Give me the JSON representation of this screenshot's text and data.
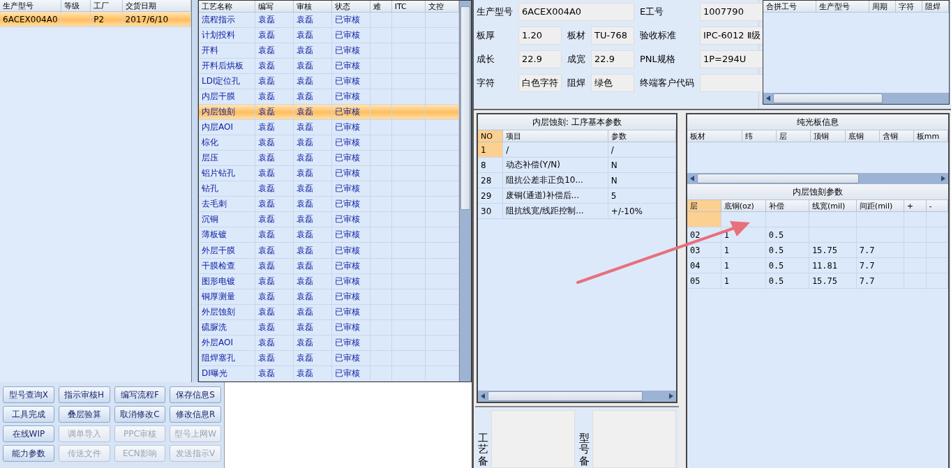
{
  "left_grid": {
    "columns": [
      "生产型号",
      "等级",
      "工厂",
      "交货日期"
    ],
    "rows": [
      {
        "cells": [
          "6ACEX004A0",
          null,
          "P2",
          "2017/6/10"
        ],
        "selected": true
      }
    ]
  },
  "process_table": {
    "columns": [
      "工艺名称",
      "编写",
      "审核",
      "状态",
      "难",
      "ITC",
      "文控"
    ],
    "rows": [
      {
        "cells": [
          "流程指示",
          "袁磊",
          "袁磊",
          "已审核"
        ],
        "selected": false
      },
      {
        "cells": [
          "计划投料",
          "袁磊",
          "袁磊",
          "已审核"
        ],
        "selected": false
      },
      {
        "cells": [
          "开料",
          "袁磊",
          "袁磊",
          "已审核"
        ],
        "selected": false
      },
      {
        "cells": [
          "开料后烘板",
          "袁磊",
          "袁磊",
          "已审核"
        ],
        "selected": false
      },
      {
        "cells": [
          "LDI定位孔",
          "袁磊",
          "袁磊",
          "已审核"
        ],
        "selected": false
      },
      {
        "cells": [
          "内层干膜",
          "袁磊",
          "袁磊",
          "已审核"
        ],
        "selected": false
      },
      {
        "cells": [
          "内层蚀刻",
          "袁磊",
          "袁磊",
          "已审核"
        ],
        "selected": true
      },
      {
        "cells": [
          "内层AOI",
          "袁磊",
          "袁磊",
          "已审核"
        ],
        "selected": false
      },
      {
        "cells": [
          "棕化",
          "袁磊",
          "袁磊",
          "已审核"
        ],
        "selected": false
      },
      {
        "cells": [
          "层压",
          "袁磊",
          "袁磊",
          "已审核"
        ],
        "selected": false
      },
      {
        "cells": [
          "铝片钻孔",
          "袁磊",
          "袁磊",
          "已审核"
        ],
        "selected": false
      },
      {
        "cells": [
          "钻孔",
          "袁磊",
          "袁磊",
          "已审核"
        ],
        "selected": false
      },
      {
        "cells": [
          "去毛刺",
          "袁磊",
          "袁磊",
          "已审核"
        ],
        "selected": false
      },
      {
        "cells": [
          "沉铜",
          "袁磊",
          "袁磊",
          "已审核"
        ],
        "selected": false
      },
      {
        "cells": [
          "薄板镀",
          "袁磊",
          "袁磊",
          "已审核"
        ],
        "selected": false
      },
      {
        "cells": [
          "外层干膜",
          "袁磊",
          "袁磊",
          "已审核"
        ],
        "selected": false
      },
      {
        "cells": [
          "干膜检查",
          "袁磊",
          "袁磊",
          "已审核"
        ],
        "selected": false
      },
      {
        "cells": [
          "图形电镀",
          "袁磊",
          "袁磊",
          "已审核"
        ],
        "selected": false
      },
      {
        "cells": [
          "铜厚测量",
          "袁磊",
          "袁磊",
          "已审核"
        ],
        "selected": false
      },
      {
        "cells": [
          "外层蚀刻",
          "袁磊",
          "袁磊",
          "已审核"
        ],
        "selected": false
      },
      {
        "cells": [
          "硫脲洗",
          "袁磊",
          "袁磊",
          "已审核"
        ],
        "selected": false
      },
      {
        "cells": [
          "外层AOI",
          "袁磊",
          "袁磊",
          "已审核"
        ],
        "selected": false
      },
      {
        "cells": [
          "阻焊塞孔",
          "袁磊",
          "袁磊",
          "已审核"
        ],
        "selected": false
      },
      {
        "cells": [
          "DI曝光",
          "袁磊",
          "袁磊",
          "已审核"
        ],
        "selected": false
      }
    ]
  },
  "buttons": [
    {
      "label": "型号查询X",
      "disabled": false
    },
    {
      "label": "指示审核H",
      "disabled": false
    },
    {
      "label": "编写流程F",
      "disabled": false
    },
    {
      "label": "保存信息S",
      "disabled": false
    },
    {
      "label": "工具完成",
      "disabled": false
    },
    {
      "label": "叠层验算",
      "disabled": false
    },
    {
      "label": "取消修改C",
      "disabled": false
    },
    {
      "label": "修改信息R",
      "disabled": false
    },
    {
      "label": "在线WIP",
      "disabled": false
    },
    {
      "label": "调单导入",
      "disabled": true
    },
    {
      "label": "PPC审核",
      "disabled": true
    },
    {
      "label": "型号上网W",
      "disabled": true
    },
    {
      "label": "能力参数",
      "disabled": false
    },
    {
      "label": "传送文件",
      "disabled": true
    },
    {
      "label": "ECN影响",
      "disabled": true
    },
    {
      "label": "发送指示V",
      "disabled": true
    }
  ],
  "form": {
    "rows": [
      [
        {
          "label": "生产型号",
          "value": "6ACEX004A0"
        },
        null,
        {
          "label": "E工号",
          "value": "1007790"
        }
      ],
      [
        {
          "label": "板厚",
          "value": "1.20"
        },
        {
          "label": "板材",
          "value": "TU-768"
        },
        {
          "label": "验收标准",
          "value": "IPC-6012 Ⅱ级"
        }
      ],
      [
        {
          "label": "成长",
          "value": "22.9"
        },
        {
          "label": "成宽",
          "value": "22.9"
        },
        {
          "label": "PNL规格",
          "value": "1P=294U"
        }
      ],
      [
        {
          "label": "字符",
          "value": "白色字符"
        },
        {
          "label": "阻焊",
          "value": "绿色"
        },
        {
          "label": "终端客户代码"
        }
      ]
    ]
  },
  "merge_grid": {
    "columns": [
      "合拼工号",
      "生产型号",
      "周期",
      "字符",
      "阻焊"
    ]
  },
  "step_params": {
    "title": "内层蚀刻: 工序基本参数",
    "columns": [
      "NO",
      "项目",
      "参数"
    ],
    "rows": [
      {
        "cells": [
          "1",
          "/",
          "/"
        ],
        "selected": true
      },
      {
        "cells": [
          "8",
          "动态补偿(Y/N)",
          "N"
        ],
        "selected": false
      },
      {
        "cells": [
          "28",
          "阻抗公差非正负10...",
          "N"
        ],
        "selected": false
      },
      {
        "cells": [
          "29",
          "废铜(通道)补偿后...",
          "5"
        ],
        "selected": false
      },
      {
        "cells": [
          "30",
          "阻抗线宽/线距控制...",
          "+/-10%"
        ],
        "selected": false
      }
    ]
  },
  "memos": [
    {
      "label": "工艺备"
    },
    {
      "label": "型号备"
    }
  ],
  "board_info": {
    "title": "纯光板信息",
    "columns": [
      "板材",
      "纬",
      "层",
      "顶铜",
      "底铜",
      "含铜",
      "板mm"
    ]
  },
  "etch_params": {
    "title": "内层蚀刻参数",
    "columns": [
      "层",
      "底铜(oz)",
      "补偿",
      "线宽(mil)",
      "间距(mil)",
      "+",
      "-"
    ],
    "rows": [
      {
        "cells": [],
        "selected": true
      },
      {
        "cells": [
          "02",
          "1",
          "0.5"
        ],
        "selected": false
      },
      {
        "cells": [
          "03",
          "1",
          "0.5",
          "15.75",
          "7.7"
        ],
        "selected": false
      },
      {
        "cells": [
          "04",
          "1",
          "0.5",
          "11.81",
          "7.7"
        ],
        "selected": false
      },
      {
        "cells": [
          "05",
          "1",
          "0.5",
          "15.75",
          "7.7"
        ],
        "selected": false
      }
    ]
  }
}
